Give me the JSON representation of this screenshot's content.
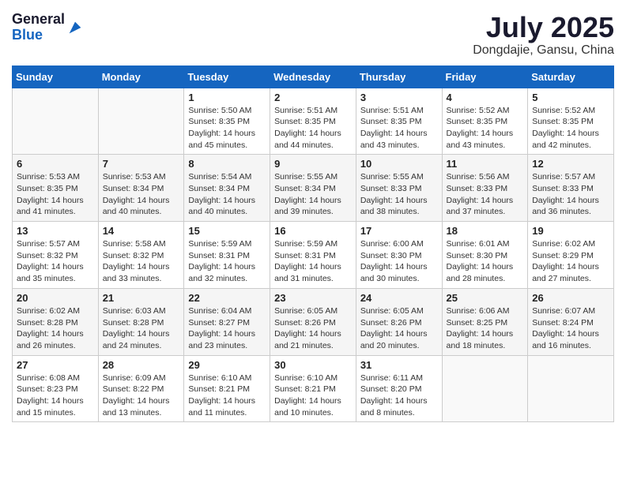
{
  "logo": {
    "general": "General",
    "blue": "Blue"
  },
  "title": "July 2025",
  "subtitle": "Dongdajie, Gansu, China",
  "days_of_week": [
    "Sunday",
    "Monday",
    "Tuesday",
    "Wednesday",
    "Thursday",
    "Friday",
    "Saturday"
  ],
  "weeks": [
    [
      {
        "day": "",
        "info": ""
      },
      {
        "day": "",
        "info": ""
      },
      {
        "day": "1",
        "sunrise": "5:50 AM",
        "sunset": "8:35 PM",
        "daylight": "14 hours and 45 minutes."
      },
      {
        "day": "2",
        "sunrise": "5:51 AM",
        "sunset": "8:35 PM",
        "daylight": "14 hours and 44 minutes."
      },
      {
        "day": "3",
        "sunrise": "5:51 AM",
        "sunset": "8:35 PM",
        "daylight": "14 hours and 43 minutes."
      },
      {
        "day": "4",
        "sunrise": "5:52 AM",
        "sunset": "8:35 PM",
        "daylight": "14 hours and 43 minutes."
      },
      {
        "day": "5",
        "sunrise": "5:52 AM",
        "sunset": "8:35 PM",
        "daylight": "14 hours and 42 minutes."
      }
    ],
    [
      {
        "day": "6",
        "sunrise": "5:53 AM",
        "sunset": "8:35 PM",
        "daylight": "14 hours and 41 minutes."
      },
      {
        "day": "7",
        "sunrise": "5:53 AM",
        "sunset": "8:34 PM",
        "daylight": "14 hours and 40 minutes."
      },
      {
        "day": "8",
        "sunrise": "5:54 AM",
        "sunset": "8:34 PM",
        "daylight": "14 hours and 40 minutes."
      },
      {
        "day": "9",
        "sunrise": "5:55 AM",
        "sunset": "8:34 PM",
        "daylight": "14 hours and 39 minutes."
      },
      {
        "day": "10",
        "sunrise": "5:55 AM",
        "sunset": "8:33 PM",
        "daylight": "14 hours and 38 minutes."
      },
      {
        "day": "11",
        "sunrise": "5:56 AM",
        "sunset": "8:33 PM",
        "daylight": "14 hours and 37 minutes."
      },
      {
        "day": "12",
        "sunrise": "5:57 AM",
        "sunset": "8:33 PM",
        "daylight": "14 hours and 36 minutes."
      }
    ],
    [
      {
        "day": "13",
        "sunrise": "5:57 AM",
        "sunset": "8:32 PM",
        "daylight": "14 hours and 35 minutes."
      },
      {
        "day": "14",
        "sunrise": "5:58 AM",
        "sunset": "8:32 PM",
        "daylight": "14 hours and 33 minutes."
      },
      {
        "day": "15",
        "sunrise": "5:59 AM",
        "sunset": "8:31 PM",
        "daylight": "14 hours and 32 minutes."
      },
      {
        "day": "16",
        "sunrise": "5:59 AM",
        "sunset": "8:31 PM",
        "daylight": "14 hours and 31 minutes."
      },
      {
        "day": "17",
        "sunrise": "6:00 AM",
        "sunset": "8:30 PM",
        "daylight": "14 hours and 30 minutes."
      },
      {
        "day": "18",
        "sunrise": "6:01 AM",
        "sunset": "8:30 PM",
        "daylight": "14 hours and 28 minutes."
      },
      {
        "day": "19",
        "sunrise": "6:02 AM",
        "sunset": "8:29 PM",
        "daylight": "14 hours and 27 minutes."
      }
    ],
    [
      {
        "day": "20",
        "sunrise": "6:02 AM",
        "sunset": "8:28 PM",
        "daylight": "14 hours and 26 minutes."
      },
      {
        "day": "21",
        "sunrise": "6:03 AM",
        "sunset": "8:28 PM",
        "daylight": "14 hours and 24 minutes."
      },
      {
        "day": "22",
        "sunrise": "6:04 AM",
        "sunset": "8:27 PM",
        "daylight": "14 hours and 23 minutes."
      },
      {
        "day": "23",
        "sunrise": "6:05 AM",
        "sunset": "8:26 PM",
        "daylight": "14 hours and 21 minutes."
      },
      {
        "day": "24",
        "sunrise": "6:05 AM",
        "sunset": "8:26 PM",
        "daylight": "14 hours and 20 minutes."
      },
      {
        "day": "25",
        "sunrise": "6:06 AM",
        "sunset": "8:25 PM",
        "daylight": "14 hours and 18 minutes."
      },
      {
        "day": "26",
        "sunrise": "6:07 AM",
        "sunset": "8:24 PM",
        "daylight": "14 hours and 16 minutes."
      }
    ],
    [
      {
        "day": "27",
        "sunrise": "6:08 AM",
        "sunset": "8:23 PM",
        "daylight": "14 hours and 15 minutes."
      },
      {
        "day": "28",
        "sunrise": "6:09 AM",
        "sunset": "8:22 PM",
        "daylight": "14 hours and 13 minutes."
      },
      {
        "day": "29",
        "sunrise": "6:10 AM",
        "sunset": "8:21 PM",
        "daylight": "14 hours and 11 minutes."
      },
      {
        "day": "30",
        "sunrise": "6:10 AM",
        "sunset": "8:21 PM",
        "daylight": "14 hours and 10 minutes."
      },
      {
        "day": "31",
        "sunrise": "6:11 AM",
        "sunset": "8:20 PM",
        "daylight": "14 hours and 8 minutes."
      },
      {
        "day": "",
        "info": ""
      },
      {
        "day": "",
        "info": ""
      }
    ]
  ]
}
